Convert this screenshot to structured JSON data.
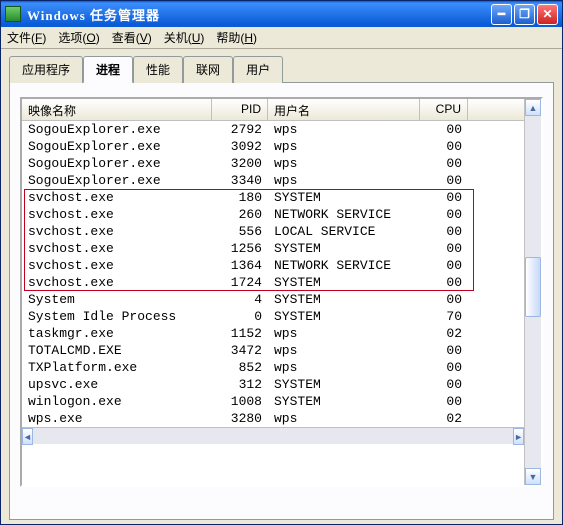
{
  "title": "Windows 任务管理器",
  "menus": [
    {
      "label": "文件(",
      "key": "F",
      "tail": ")"
    },
    {
      "label": "选项(",
      "key": "O",
      "tail": ")"
    },
    {
      "label": "查看(",
      "key": "V",
      "tail": ")"
    },
    {
      "label": "关机(",
      "key": "U",
      "tail": ")"
    },
    {
      "label": "帮助(",
      "key": "H",
      "tail": ")"
    }
  ],
  "tabs": [
    "应用程序",
    "进程",
    "性能",
    "联网",
    "用户"
  ],
  "activeTab": 1,
  "columns": {
    "image": "映像名称",
    "pid": "PID",
    "user": "用户名",
    "cpu": "CPU"
  },
  "colWidths": {
    "image": 190,
    "pid": 56,
    "user": 152,
    "cpu": 48
  },
  "rows": [
    {
      "image": "SogouExplorer.exe",
      "pid": "2792",
      "user": "wps",
      "cpu": "00"
    },
    {
      "image": "SogouExplorer.exe",
      "pid": "3092",
      "user": "wps",
      "cpu": "00"
    },
    {
      "image": "SogouExplorer.exe",
      "pid": "3200",
      "user": "wps",
      "cpu": "00"
    },
    {
      "image": "SogouExplorer.exe",
      "pid": "3340",
      "user": "wps",
      "cpu": "00"
    },
    {
      "image": "svchost.exe",
      "pid": "180",
      "user": "SYSTEM",
      "cpu": "00"
    },
    {
      "image": "svchost.exe",
      "pid": "260",
      "user": "NETWORK SERVICE",
      "cpu": "00"
    },
    {
      "image": "svchost.exe",
      "pid": "556",
      "user": "LOCAL SERVICE",
      "cpu": "00"
    },
    {
      "image": "svchost.exe",
      "pid": "1256",
      "user": "SYSTEM",
      "cpu": "00"
    },
    {
      "image": "svchost.exe",
      "pid": "1364",
      "user": "NETWORK SERVICE",
      "cpu": "00"
    },
    {
      "image": "svchost.exe",
      "pid": "1724",
      "user": "SYSTEM",
      "cpu": "00"
    },
    {
      "image": "System",
      "pid": "4",
      "user": "SYSTEM",
      "cpu": "00"
    },
    {
      "image": "System Idle Process",
      "pid": "0",
      "user": "SYSTEM",
      "cpu": "70"
    },
    {
      "image": "taskmgr.exe",
      "pid": "1152",
      "user": "wps",
      "cpu": "02"
    },
    {
      "image": "TOTALCMD.EXE",
      "pid": "3472",
      "user": "wps",
      "cpu": "00"
    },
    {
      "image": "TXPlatform.exe",
      "pid": "852",
      "user": "wps",
      "cpu": "00"
    },
    {
      "image": "upsvc.exe",
      "pid": "312",
      "user": "SYSTEM",
      "cpu": "00"
    },
    {
      "image": "winlogon.exe",
      "pid": "1008",
      "user": "SYSTEM",
      "cpu": "00"
    },
    {
      "image": "wps.exe",
      "pid": "3280",
      "user": "wps",
      "cpu": "02"
    }
  ],
  "highlightRows": {
    "start": 4,
    "end": 9
  },
  "scrollArrows": {
    "up": "▲",
    "down": "▼",
    "left": "◄",
    "right": "►"
  }
}
